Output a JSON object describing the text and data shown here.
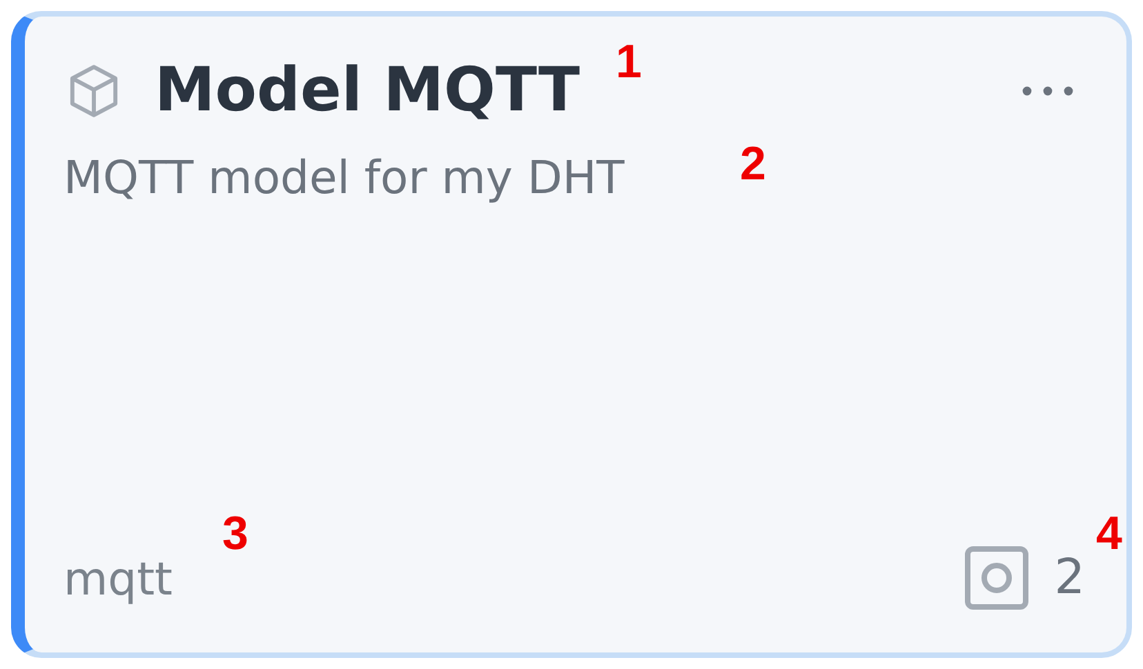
{
  "card": {
    "title": "Model MQTT",
    "description": "MQTT model for my DHT",
    "tag": "mqtt",
    "count": "2"
  },
  "callouts": [
    "1",
    "2",
    "3",
    "4"
  ]
}
